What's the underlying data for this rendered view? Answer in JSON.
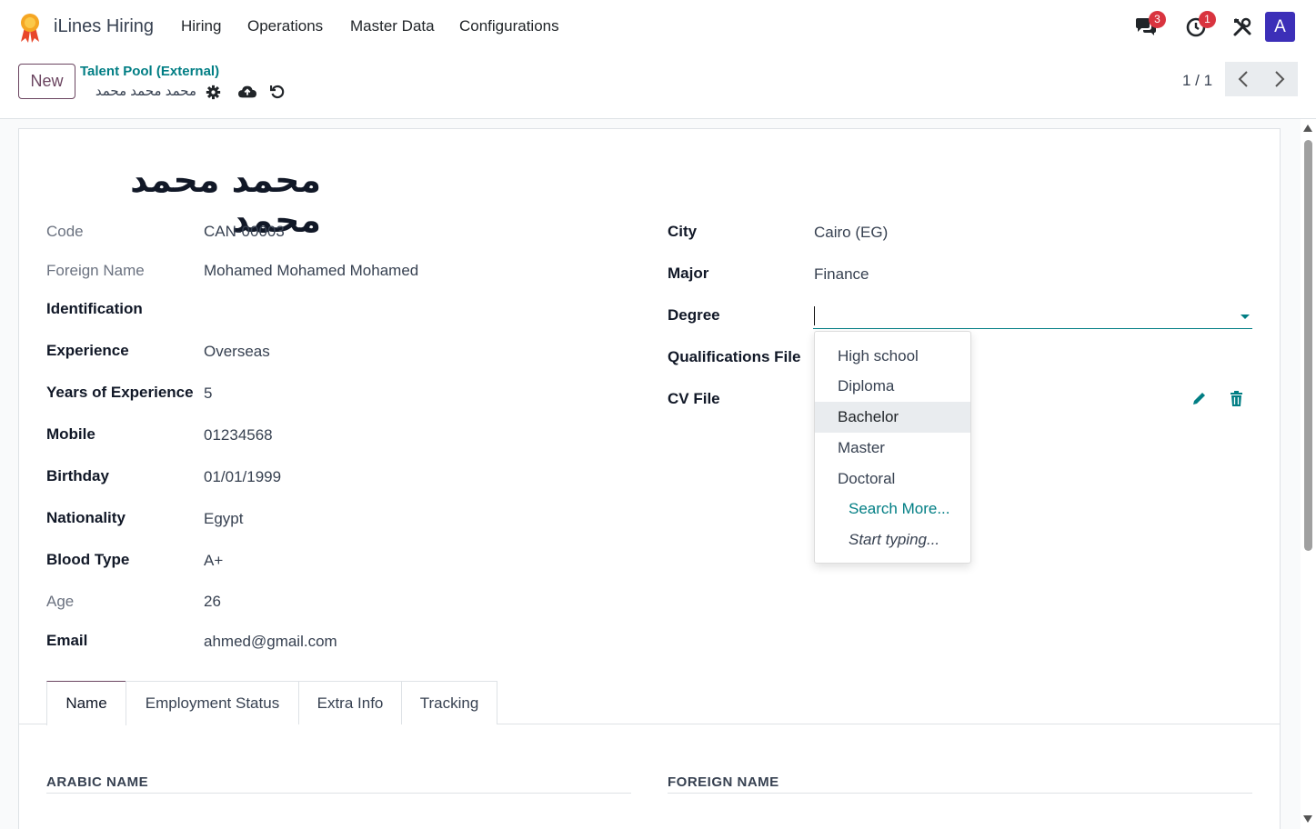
{
  "navbar": {
    "app_name": "iLines Hiring",
    "menu": [
      "Hiring",
      "Operations",
      "Master Data",
      "Configurations"
    ],
    "messages_count": "3",
    "activities_count": "1",
    "avatar_letter": "A",
    "icons": {
      "messages": "chat-icon",
      "activities": "clock-icon",
      "tools": "tools-icon",
      "logo": "ribbon-logo-icon"
    }
  },
  "control_panel": {
    "new_label": "New",
    "breadcrumb_parent": "Talent Pool (External)",
    "breadcrumb_current": "محمد محمد محمد",
    "pager_value": "1 / 1"
  },
  "record": {
    "title": "محمد محمد محمد",
    "left_fields": [
      {
        "label": "Code",
        "value": "CAN-00003"
      },
      {
        "label": "Foreign Name",
        "value": "Mohamed Mohamed Mohamed"
      },
      {
        "label": "Identification",
        "value": ""
      },
      {
        "label": "Experience",
        "value": "Overseas"
      },
      {
        "label": "Years of Experience",
        "value": "5"
      },
      {
        "label": "Mobile",
        "value": "01234568"
      },
      {
        "label": "Birthday",
        "value": "01/01/1999"
      },
      {
        "label": "Nationality",
        "value": "Egypt"
      },
      {
        "label": "Blood Type",
        "value": "A+"
      },
      {
        "label": "Age",
        "value": "26"
      },
      {
        "label": "Email",
        "value": "ahmed@gmail.com"
      }
    ],
    "right_fields": [
      {
        "label": "City",
        "value": "Cairo (EG)"
      },
      {
        "label": "Major",
        "value": "Finance"
      },
      {
        "label": "Degree",
        "value": ""
      },
      {
        "label": "Qualifications File",
        "value": ""
      },
      {
        "label": "CV File",
        "value": ""
      }
    ]
  },
  "degree_dropdown": {
    "options": [
      "High school",
      "Diploma",
      "Bachelor",
      "Master",
      "Doctoral"
    ],
    "highlighted": "Bachelor",
    "search_more": "Search More...",
    "start_typing": "Start typing..."
  },
  "tabs": [
    "Name",
    "Employment Status",
    "Extra Info",
    "Tracking"
  ],
  "active_tab": "Name",
  "sections": {
    "arabic_name": "ARABIC NAME",
    "foreign_name": "FOREIGN NAME"
  },
  "colors": {
    "accent": "#017e84",
    "brand": "#6b4560",
    "badge": "#d9343f",
    "avatar": "#3c2fb8"
  }
}
